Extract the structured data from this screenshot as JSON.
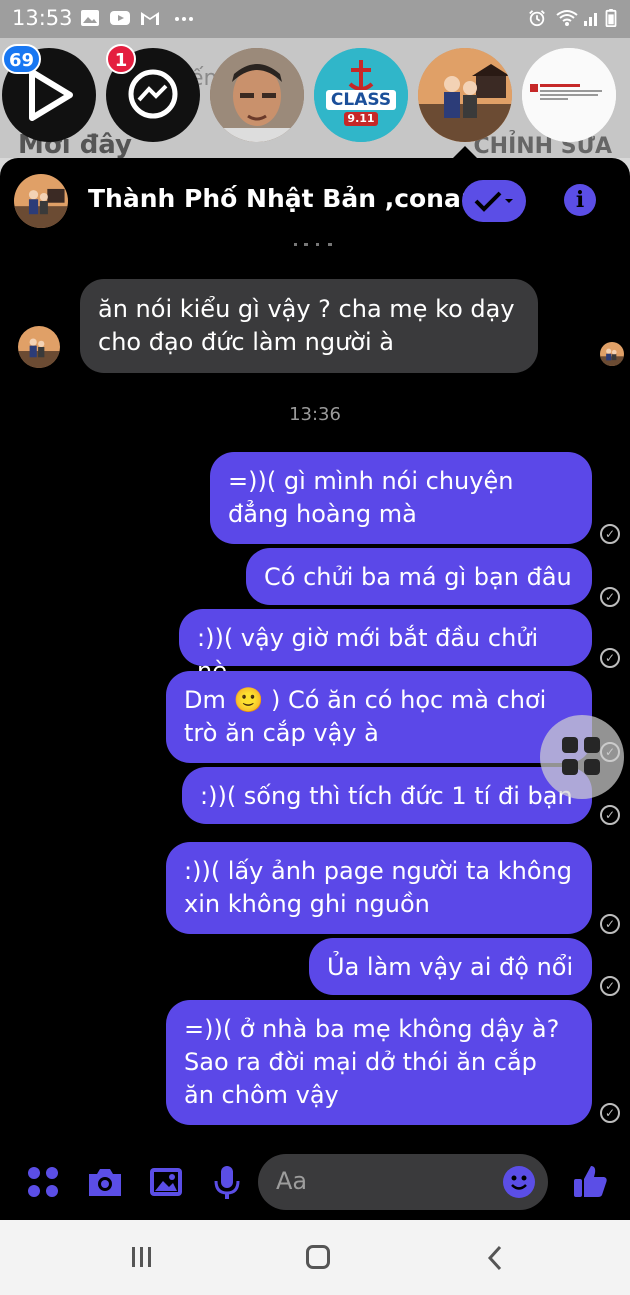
{
  "status_bar": {
    "time": "13:53",
    "left_icons": [
      "gallery-icon",
      "youtube-icon",
      "gmail-icon",
      "more-icon"
    ],
    "right_icons": [
      "alarm-icon",
      "wifi-icon",
      "signal-icon",
      "battery-icon"
    ]
  },
  "backdrop": {
    "title_left": "Mới đây",
    "title_right": "CHỈNH SỬA",
    "snippet": "ến"
  },
  "chat_heads": [
    {
      "name": "video-chat-head",
      "badge": "69",
      "badge_color": "#1877f2"
    },
    {
      "name": "messenger-chat-head",
      "badge": "1",
      "badge_color": "#e41e3f"
    },
    {
      "name": "man-avatar-chat-head"
    },
    {
      "name": "class-logo-chat-head",
      "logo_text": "CLASS",
      "logo_sub": "9.11"
    },
    {
      "name": "conan-chat-head"
    },
    {
      "name": "page-screenshot-chat-head"
    }
  ],
  "conversation": {
    "title": "Thành Phố Nhật Bản ,conan",
    "accent_color": "#5b48e8"
  },
  "messages": {
    "incoming": "ăn nói kiểu gì vậy ? cha mẹ ko dạy cho đạo đức làm người à",
    "timestamp": "13:36",
    "outgoing": [
      "=))( gì mình nói chuyện đẳng hoàng mà",
      "Có chửi ba má gì bạn đâu",
      ":))( vậy giờ mới bắt đầu chửi nè",
      "Dm 🙂 ) Có ăn có học mà chơi trò ăn cắp vậy à",
      ":))( sống thì tích đức 1 tí đi bạn",
      ":))( lấy ảnh page người ta không xin không ghi nguồn",
      "Ủa làm vậy ai độ nổi",
      "=))( ở nhà ba mẹ không dậy à? Sao ra đời mại dở thói ăn cắp ăn chôm vậy"
    ]
  },
  "composer": {
    "placeholder": "Aa"
  }
}
